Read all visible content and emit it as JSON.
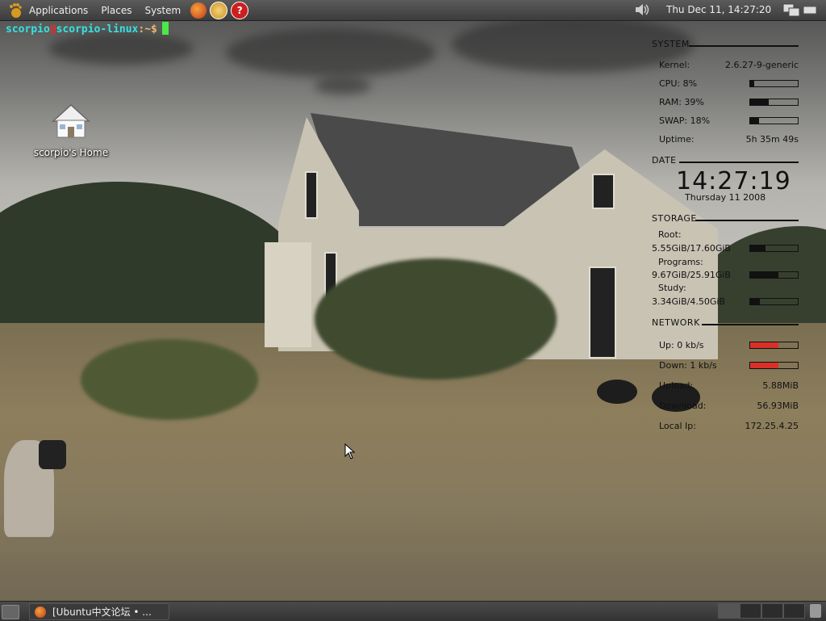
{
  "top_panel": {
    "menus": [
      "Applications",
      "Places",
      "System"
    ],
    "clock": "Thu Dec 11, 14:27:20",
    "launchers": [
      "firefox-icon",
      "pidgin-icon",
      "help-icon"
    ],
    "tray": [
      "volume-icon",
      "network-icon",
      "keyboard-icon"
    ]
  },
  "terminal": {
    "user": "scorpio",
    "at": "@",
    "host": "scorpio-linux",
    "path": ":~$"
  },
  "desktop": {
    "home_label": "scorpio's Home"
  },
  "conky": {
    "system": {
      "heading": "SYSTEM",
      "kernel_label": "Kernel:",
      "kernel_value": "2.6.27-9-generic",
      "cpu_label": "CPU: 8%",
      "cpu": 0.08,
      "ram_label": "RAM: 39%",
      "ram": 0.39,
      "swap_label": "SWAP: 18%",
      "swap": 0.18,
      "uptime_label": "Uptime:",
      "uptime_value": "5h 35m 49s"
    },
    "date": {
      "heading": "DATE",
      "time": "14:27:19",
      "date": "Thursday 11 2008"
    },
    "storage": {
      "heading": "STORAGE",
      "items": [
        {
          "name": "Root:",
          "usage": "5.55GiB/17.60GiB",
          "fraction": 0.32
        },
        {
          "name": "Programs:",
          "usage": "9.67GiB/25.91GiB",
          "fraction": 0.6
        },
        {
          "name": "Study:",
          "usage": "3.34GiB/4.50GiB",
          "fraction": 0.2
        }
      ]
    },
    "network": {
      "heading": "NETWORK",
      "up_label": "Up: 0 kb/s",
      "up": 0.6,
      "down_label": "Down: 1 kb/s",
      "down": 0.6,
      "upload_label": "Upload:",
      "upload_value": "5.88MiB",
      "download_label": "Download:",
      "download_value": "56.93MiB",
      "ip_label": "Local Ip:",
      "ip_value": "172.25.4.25"
    },
    "colors": {
      "text": "#111111",
      "net_bar": "#d9302a"
    }
  },
  "bottom_panel": {
    "task_label": "[Ubuntu中文论坛 • ...",
    "workspaces": 4,
    "active_workspace": 1
  }
}
